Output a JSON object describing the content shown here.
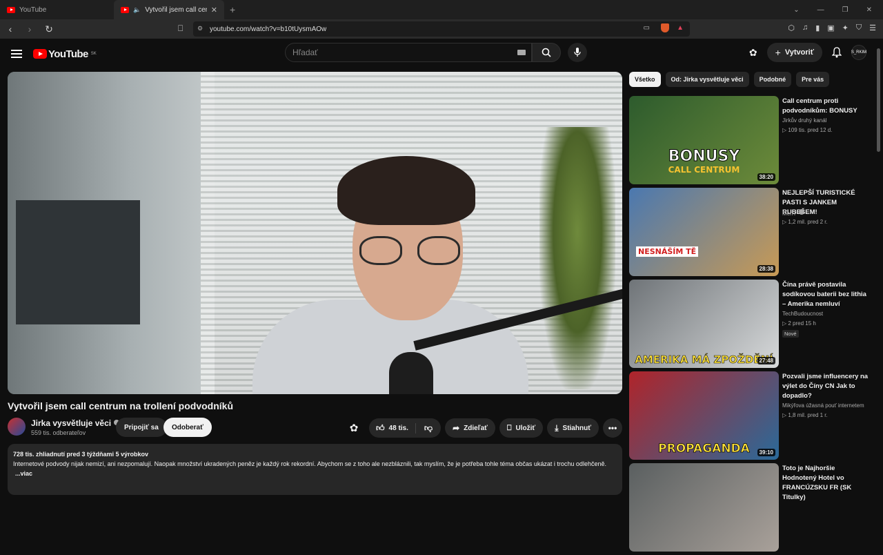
{
  "browser": {
    "tabs": [
      {
        "title": "YouTube"
      },
      {
        "title": "Vytvořil jsem call centrum na"
      }
    ],
    "url": "youtube.com/watch?v=b10tUysmAOw"
  },
  "header": {
    "logo_text": "YouTube",
    "region": "SK",
    "search_placeholder": "Hľadať",
    "create_label": "Vytvoriť",
    "avatar_text": "S_RKIM"
  },
  "video": {
    "title": "Vytvořil jsem call centrum na trollení podvodníků",
    "channel": "Jirka vysvětluje věci",
    "subscribers": "559 tis. odberateľov",
    "join_label": "Pripojiť sa",
    "subscribe_label": "Odoberať",
    "likes": "48 tis.",
    "share_label": "Zdieľať",
    "save_label": "Uložiť",
    "download_label": "Stiahnuť",
    "views_meta": "728 tis. zhliadnutí  pred 3 týždňami  5 výrobkov",
    "description": "Internetové podvody nijak nemizí, ani nezpomalují. Naopak množství ukradených peněz je každý rok rekordní. Abychom se z toho ale nezbláznili, tak myslím, že je potřeba tohle téma občas ukázat i trochu odlehčeně.",
    "more_label": "...viac"
  },
  "chips": [
    "Všetko",
    "Od: Jirka vysvětluje věci",
    "Podobné",
    "Pre vás"
  ],
  "recommendations": [
    {
      "title": "Call centrum proti podvodníkům: BONUSY",
      "channel": "Jirkův druhý kanál",
      "meta": "▷ 109 tis.   pred 12 d.",
      "duration": "38:20",
      "overlay": "BONUSY",
      "overlay2": "CALL CENTRUM",
      "colors": [
        "#2d5b2d",
        "#6d8b3a"
      ]
    },
    {
      "title": "NEJLEPŠÍ TURISTICKÉ PASTI S JANKEM RUBEŠEM!",
      "channel": "MenT",
      "meta": "▷ 1,2 mil.   pred 2 r.",
      "duration": "28:38",
      "overlay": "NESNÁŠÍM TĚ",
      "overlay2": "",
      "colors": [
        "#4a78b0",
        "#c89a55"
      ]
    },
    {
      "title": "Čína právě postavila sodíkovou baterii bez lithia – Amerika nemluví",
      "channel": "TechBudoucnost",
      "meta": "▷ 2   pred 15 h",
      "duration": "27:48",
      "overlay": "AMERIKA MÁ ZPOŽDĚNÍ",
      "overlay2": "",
      "badge": "Nové",
      "colors": [
        "#6f7478",
        "#d8dadb"
      ]
    },
    {
      "title": "Pozvali jsme influencery na výlet do Číny CN Jak to dopadlo?",
      "channel": "Mikýřova úžasná pouť internetem",
      "meta": "▷ 1,8 mil.   pred 1 r.",
      "duration": "39:10",
      "overlay": "PROPAGANDA",
      "overlay2": "",
      "colors": [
        "#b0242a",
        "#2a6a9a"
      ]
    },
    {
      "title": "Toto je Najhoršie Hodnotený Hotel vo FRANCÚZSKU FR (SK Titulky)",
      "channel": "",
      "meta": "",
      "duration": "",
      "overlay": "",
      "overlay2": "",
      "colors": [
        "#5a5f60",
        "#a9a19a"
      ]
    }
  ]
}
